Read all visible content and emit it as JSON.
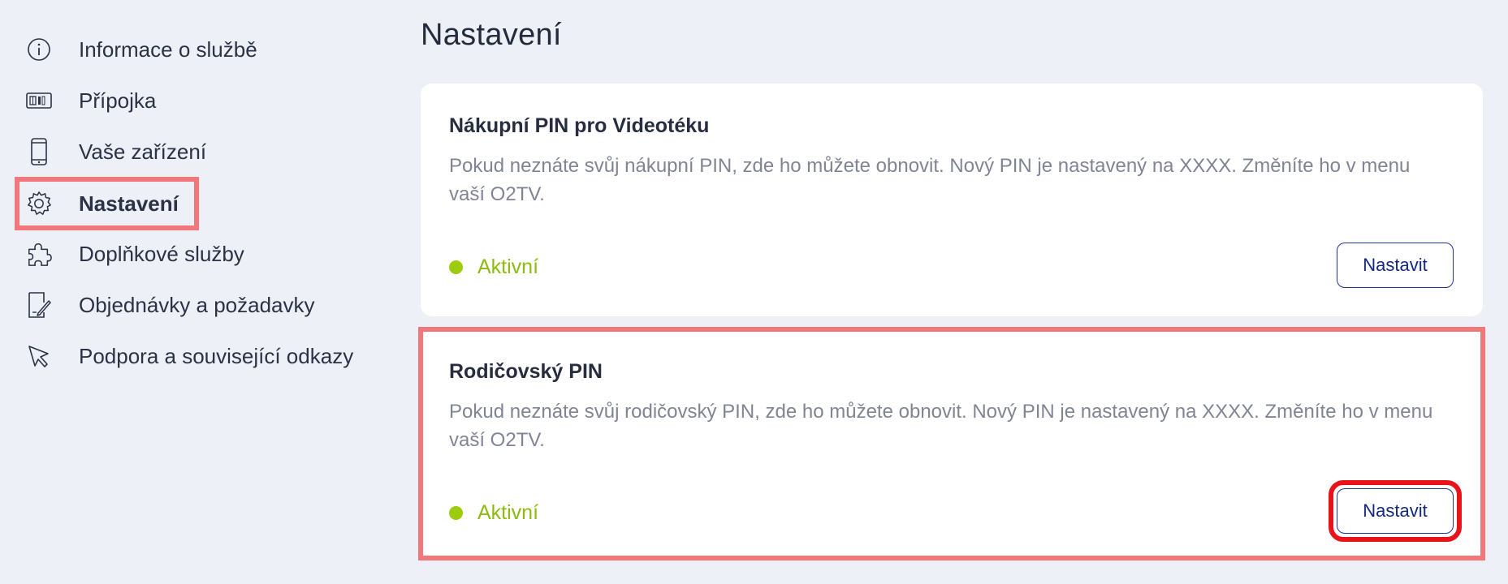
{
  "sidebar": {
    "items": [
      {
        "label": "Informace o službě",
        "icon": "info-icon"
      },
      {
        "label": "Přípojka",
        "icon": "sim-card-icon"
      },
      {
        "label": "Vaše zařízení",
        "icon": "phone-icon"
      },
      {
        "label": "Nastavení",
        "icon": "gear-icon",
        "active": true
      },
      {
        "label": "Doplňkové služby",
        "icon": "puzzle-icon"
      },
      {
        "label": "Objednávky a požadavky",
        "icon": "document-edit-icon"
      },
      {
        "label": "Podpora a související odkazy",
        "icon": "cursor-click-icon"
      }
    ]
  },
  "main": {
    "title": "Nastavení",
    "cards": [
      {
        "title": "Nákupní PIN pro Videotéku",
        "description": "Pokud neznáte svůj nákupní PIN, zde ho můžete obnovit. Nový PIN je nastavený na XXXX. Změníte ho v menu vaší O2TV.",
        "status": "Aktivní",
        "button": "Nastavit"
      },
      {
        "title": "Rodičovský PIN",
        "description": "Pokud neznáte svůj rodičovský PIN, zde ho můžete obnovit. Nový PIN je nastavený na XXXX. Změníte ho v menu vaší O2TV.",
        "status": "Aktivní",
        "button": "Nastavit"
      }
    ]
  },
  "colors": {
    "background": "#edf0f7",
    "status_active": "#9ccc0c",
    "button_border": "#1f3591",
    "highlight_pink": "#f2777a",
    "highlight_red": "#e8141a"
  }
}
